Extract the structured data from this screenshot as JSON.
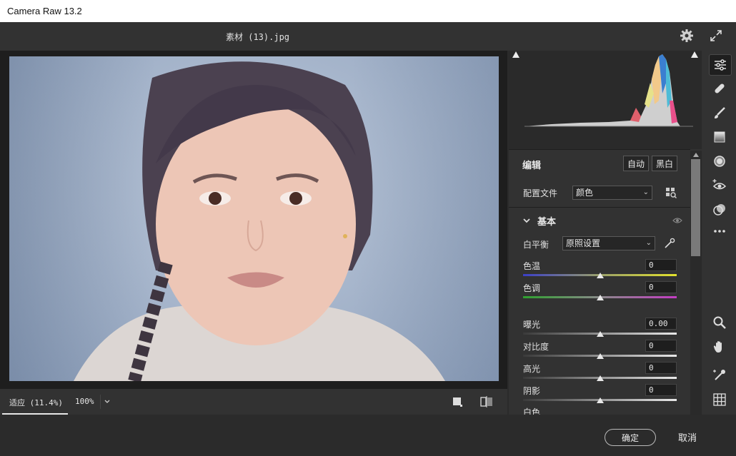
{
  "window": {
    "title": "Camera Raw 13.2"
  },
  "document": {
    "filename": "素材 (13).jpg"
  },
  "canvas": {
    "zoom_fit_label": "适应 (11.4%)",
    "zoom_100_label": "100%"
  },
  "panel": {
    "edit": {
      "title": "编辑",
      "auto_label": "自动",
      "bw_label": "黑白"
    },
    "profile": {
      "label": "配置文件",
      "value": "颜色"
    },
    "basic": {
      "title": "基本",
      "white_balance": {
        "label": "白平衡",
        "value": "原照设置"
      },
      "sliders": [
        {
          "label": "色温",
          "value": "0",
          "position": 0.5
        },
        {
          "label": "色调",
          "value": "0",
          "position": 0.5
        },
        {
          "label": "曝光",
          "value": "0.00",
          "position": 0.5
        },
        {
          "label": "对比度",
          "value": "0",
          "position": 0.5
        },
        {
          "label": "高光",
          "value": "0",
          "position": 0.5
        },
        {
          "label": "阴影",
          "value": "0",
          "position": 0.5
        },
        {
          "label": "白色",
          "value": "",
          "position": 0.5
        }
      ]
    }
  },
  "footer": {
    "ok_label": "确定",
    "cancel_label": "取消"
  },
  "colors": {
    "panel_bg": "#323232",
    "canvas_bg": "#1e1e1e",
    "accent": "#e8e8e8"
  },
  "icons": [
    "gear-icon",
    "expand-icon",
    "sliders-icon",
    "healing-icon",
    "brush-icon",
    "gradient-icon",
    "radial-icon",
    "redeye-icon",
    "presets-icon",
    "more-icon",
    "zoom-icon",
    "hand-icon",
    "eyedropper-icon",
    "grid-icon"
  ]
}
